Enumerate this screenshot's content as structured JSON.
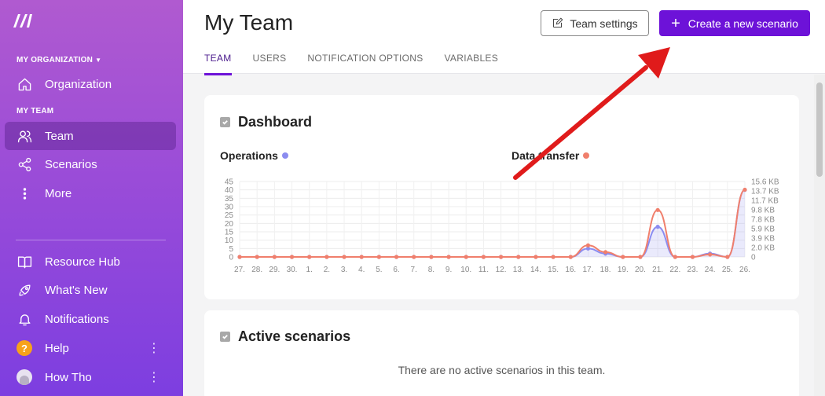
{
  "sidebar": {
    "org_section": "MY ORGANIZATION",
    "org_item": "Organization",
    "team_section": "MY TEAM",
    "items": [
      {
        "label": "Team"
      },
      {
        "label": "Scenarios"
      },
      {
        "label": "More"
      }
    ],
    "bottom_items": [
      {
        "label": "Resource Hub"
      },
      {
        "label": "What's New"
      },
      {
        "label": "Notifications"
      },
      {
        "label": "Help"
      },
      {
        "label": "How Tho"
      }
    ],
    "help_glyph": "?"
  },
  "header": {
    "title": "My Team",
    "settings_label": "Team settings",
    "create_label": "Create a new scenario",
    "tabs": [
      {
        "label": "TEAM"
      },
      {
        "label": "USERS"
      },
      {
        "label": "NOTIFICATION OPTIONS"
      },
      {
        "label": "VARIABLES"
      }
    ]
  },
  "dashboard": {
    "title": "Dashboard",
    "operations_label": "Operations",
    "data_transfer_label": "Data transfer"
  },
  "active": {
    "title": "Active scenarios",
    "empty_message": "There are no active scenarios in this team."
  },
  "colors": {
    "accent": "#6d12d8",
    "operations": "#8b8cf0",
    "data_transfer": "#f07f6c",
    "arrow": "#e01b1b"
  },
  "chart_data": {
    "type": "line",
    "categories": [
      "27.",
      "28.",
      "29.",
      "30.",
      "1.",
      "2.",
      "3.",
      "4.",
      "5.",
      "6.",
      "7.",
      "8.",
      "9.",
      "10.",
      "11.",
      "12.",
      "13.",
      "14.",
      "15.",
      "16.",
      "17.",
      "18.",
      "19.",
      "20.",
      "21.",
      "22.",
      "23.",
      "24.",
      "25.",
      "26."
    ],
    "left_ticks": [
      "45",
      "40",
      "35",
      "30",
      "25",
      "20",
      "15",
      "10",
      "5",
      "0"
    ],
    "right_ticks": [
      "15.6 KB",
      "13.7 KB",
      "11.7 KB",
      "9.8 KB",
      "7.8 KB",
      "5.9 KB",
      "3.9 KB",
      "2.0 KB",
      "0"
    ],
    "ylim_left": [
      0,
      45
    ],
    "ylim_right_kb": [
      0,
      15.6
    ],
    "series": [
      {
        "name": "Operations",
        "axis": "left",
        "values": [
          0,
          0,
          0,
          0,
          0,
          0,
          0,
          0,
          0,
          0,
          0,
          0,
          0,
          0,
          0,
          0,
          0,
          0,
          0,
          0,
          5,
          2,
          0,
          0,
          18,
          0,
          0,
          2,
          0,
          40
        ]
      },
      {
        "name": "Data transfer",
        "axis": "right",
        "values": [
          0,
          0,
          0,
          0,
          0,
          0,
          0,
          0,
          0,
          0,
          0,
          0,
          0,
          0,
          0,
          0,
          0,
          0,
          0,
          0,
          2.4,
          1.0,
          0,
          0,
          9.7,
          0,
          0,
          0.5,
          0,
          13.9
        ]
      }
    ]
  }
}
